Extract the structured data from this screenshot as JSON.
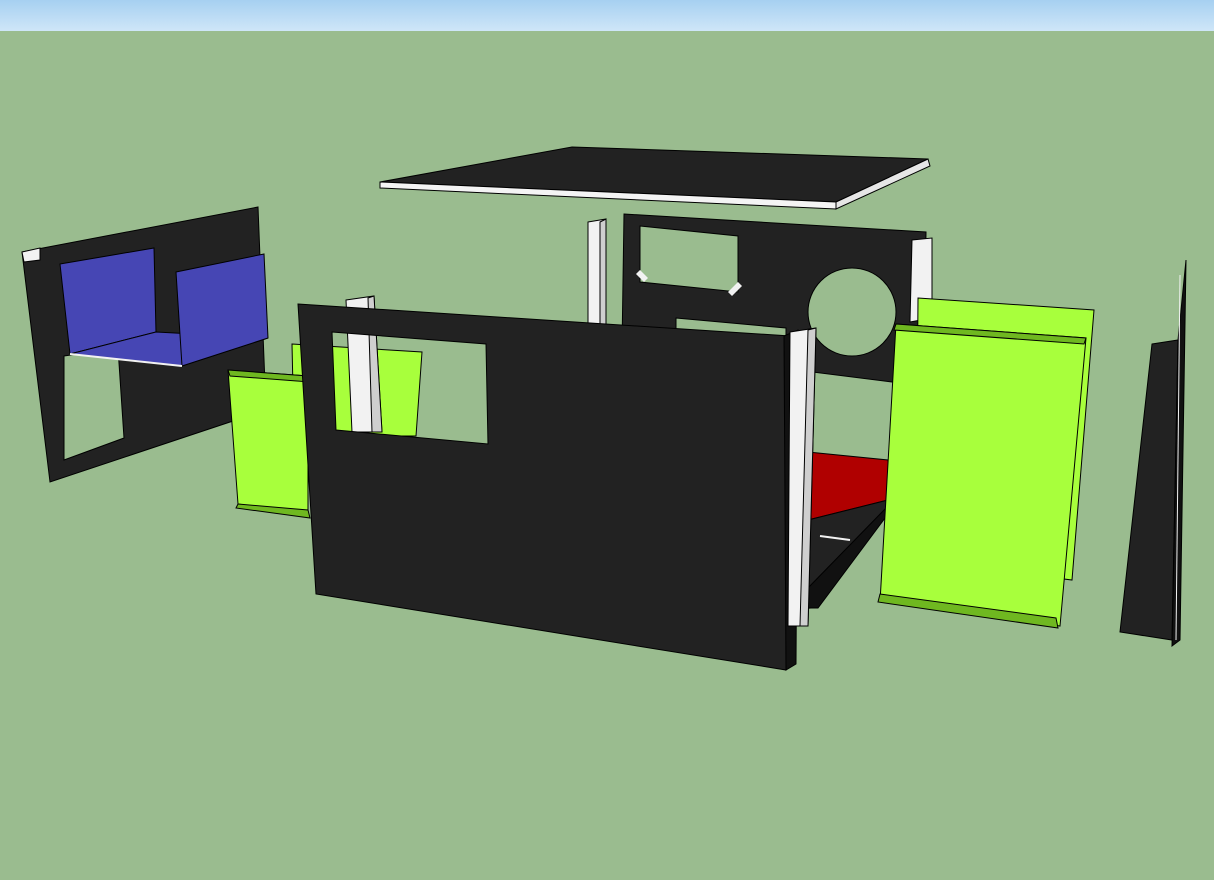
{
  "viewport": {
    "sky_color": "#bfe0f7",
    "ground_color": "#9abc8f"
  },
  "materials": {
    "panel": "#222222",
    "edge": "#f2f2f2",
    "green": "#a8ff3c",
    "blue": "#4646b4",
    "red": "#b00000",
    "post": "#eeeeee"
  },
  "model": {
    "name": "exploded-enclosure-assembly",
    "parts": [
      "top-panel",
      "left-end-panel",
      "blue-tray",
      "rear-panel",
      "front-panel",
      "left-green-bracket",
      "right-green-bracket",
      "corner-posts",
      "red-base",
      "right-end-panel"
    ]
  }
}
